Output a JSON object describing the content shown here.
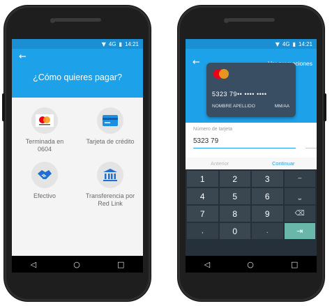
{
  "status": {
    "net": "4G",
    "time": "14:21"
  },
  "screen1": {
    "back_icon": "←",
    "title": "¿Cómo quieres pagar?",
    "options": [
      {
        "label": "Terminada en\n0604",
        "icon": "mastercard-icon"
      },
      {
        "label": "Tarjeta de crédito",
        "icon": "credit-card-icon"
      },
      {
        "label": "Efectivo",
        "icon": "handshake-icon"
      },
      {
        "label": "Transferencia por\nRed Link",
        "icon": "bank-icon"
      }
    ]
  },
  "screen2": {
    "back_icon": "←",
    "promo_link": "Ver promociones",
    "card": {
      "brand": "mastercard",
      "number": "5323 79•• •••• ••••",
      "name": "NOMBRE APELLIDO",
      "expiry": "MM/AA"
    },
    "field": {
      "label": "Número de tarjeta",
      "value": "5323 79"
    },
    "prev_label": "Anterior",
    "next_label": "Continuar",
    "keys": [
      "1",
      "2",
      "3",
      "−",
      "4",
      "5",
      "6",
      "⎵",
      "7",
      "8",
      "9",
      "⌫",
      ",",
      "0",
      ".",
      "⇥"
    ]
  },
  "nav": {
    "back": "◁",
    "home": "○",
    "recents": "□"
  },
  "colors": {
    "header": "#1da1e8",
    "keypad": "#25303a",
    "enter": "#6ab7a9"
  }
}
